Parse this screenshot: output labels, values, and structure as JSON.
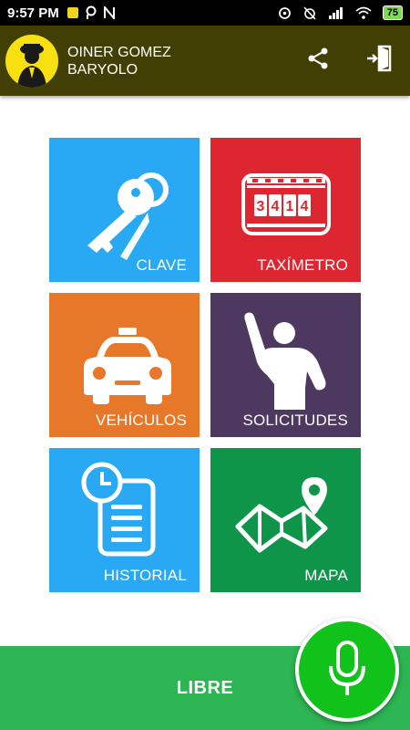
{
  "status_bar": {
    "time": "9:57 PM",
    "battery": "75"
  },
  "header": {
    "driver_name": "OINER GOMEZ BARYOLO",
    "share_icon": "share-icon",
    "logout_icon": "logout-door-icon"
  },
  "tiles": [
    {
      "label": "CLAVE",
      "color": "#29a8f4",
      "icon": "keys-icon"
    },
    {
      "label": "TAXÍMETRO",
      "color": "#dd2630",
      "icon": "taximeter-icon"
    },
    {
      "label": "VEHÍCULOS",
      "color": "#e7782a",
      "icon": "taxi-car-icon"
    },
    {
      "label": "SOLICITUDES",
      "color": "#4d3960",
      "icon": "raised-hand-person-icon"
    },
    {
      "label": "HISTORIAL",
      "color": "#29a8f4",
      "icon": "clock-document-icon"
    },
    {
      "label": "MAPA",
      "color": "#0e9549",
      "icon": "map-pin-icon"
    }
  ],
  "bottom_bar": {
    "status_label": "LIBRE",
    "color": "#2cb552",
    "mic_icon": "microphone-icon"
  }
}
